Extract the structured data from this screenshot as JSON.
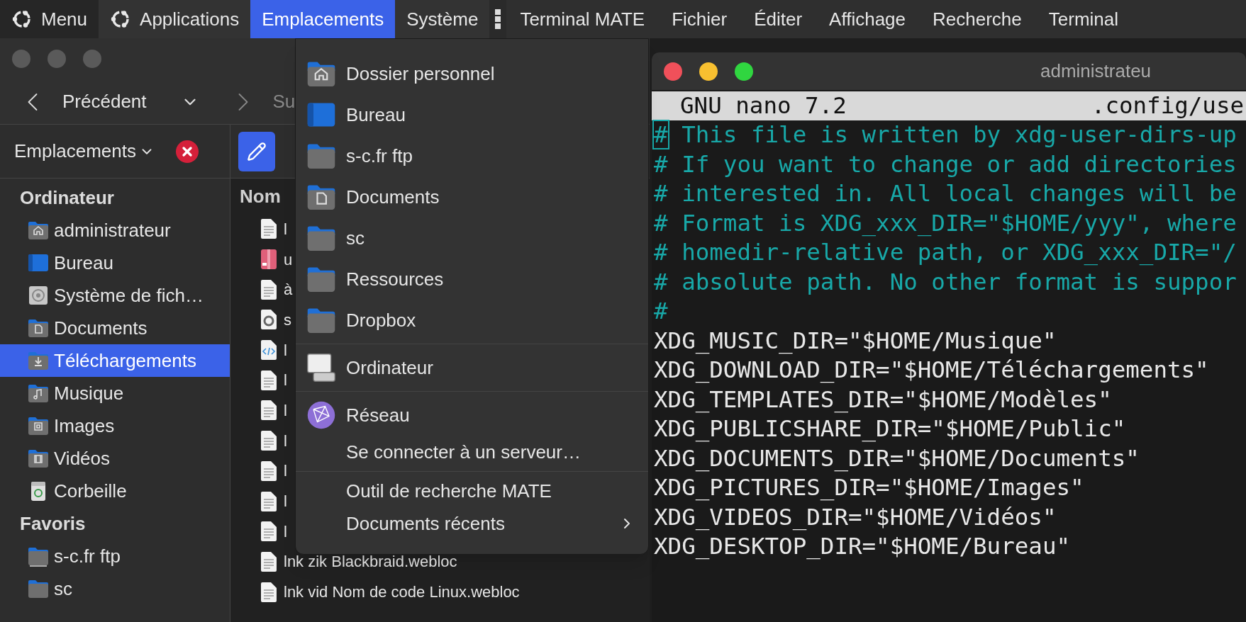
{
  "top_panel": {
    "items": [
      {
        "label": "Menu",
        "kind": "logo",
        "selected": false
      },
      {
        "label": "Applications",
        "kind": "logo",
        "selected": false
      },
      {
        "label": "Emplacements",
        "kind": "plain",
        "selected": true
      },
      {
        "label": "Système",
        "kind": "plain",
        "selected": false
      }
    ],
    "app_menus": [
      "Terminal MATE",
      "Fichier",
      "Éditer",
      "Affichage",
      "Recherche",
      "Terminal"
    ]
  },
  "file_manager": {
    "toolbar": {
      "back": "Précédent",
      "forward": "Su"
    },
    "sidebar": {
      "header": "Emplacements",
      "sections": [
        {
          "title": "Ordinateur",
          "items": [
            {
              "label": "administrateur",
              "kind": "home",
              "selected": false
            },
            {
              "label": "Bureau",
              "kind": "desktop",
              "selected": false
            },
            {
              "label": "Système de fich…",
              "kind": "disk",
              "selected": false
            },
            {
              "label": "Documents",
              "kind": "documents",
              "selected": false
            },
            {
              "label": "Téléchargements",
              "kind": "download",
              "selected": true
            },
            {
              "label": "Musique",
              "kind": "music",
              "selected": false
            },
            {
              "label": "Images",
              "kind": "pictures",
              "selected": false
            },
            {
              "label": "Vidéos",
              "kind": "videos",
              "selected": false
            },
            {
              "label": "Corbeille",
              "kind": "trash",
              "selected": false
            }
          ]
        },
        {
          "title": "Favoris",
          "items": [
            {
              "label": "s-c.fr ftp",
              "kind": "remote",
              "selected": false
            },
            {
              "label": "sc",
              "kind": "folder",
              "selected": false
            }
          ]
        }
      ]
    },
    "columns": [
      "Nom"
    ],
    "files": [
      {
        "name": "l",
        "kind": "text"
      },
      {
        "name": "u",
        "kind": "archive"
      },
      {
        "name": "à",
        "kind": "text"
      },
      {
        "name": "s",
        "kind": "disc"
      },
      {
        "name": "l",
        "kind": "code"
      },
      {
        "name": "l",
        "kind": "text"
      },
      {
        "name": "l",
        "kind": "text"
      },
      {
        "name": "l",
        "kind": "text"
      },
      {
        "name": "l",
        "kind": "text"
      },
      {
        "name": "l",
        "kind": "text"
      },
      {
        "name": "l",
        "kind": "text"
      },
      {
        "name": "lnk zik Blackbraid.webloc",
        "kind": "text"
      },
      {
        "name": "lnk vid Nom de code Linux.webloc",
        "kind": "text"
      }
    ]
  },
  "places_menu": {
    "groups": [
      [
        {
          "label": "Dossier personnel",
          "kind": "home"
        },
        {
          "label": "Bureau",
          "kind": "desktop"
        },
        {
          "label": "s-c.fr ftp",
          "kind": "folder"
        },
        {
          "label": "Documents",
          "kind": "documents"
        },
        {
          "label": "sc",
          "kind": "folder"
        },
        {
          "label": "Ressources",
          "kind": "folder"
        },
        {
          "label": "Dropbox",
          "kind": "folder"
        }
      ],
      [
        {
          "label": "Ordinateur",
          "kind": "computer"
        }
      ],
      [
        {
          "label": "Réseau",
          "kind": "network"
        },
        {
          "label": "Se connecter à un serveur…",
          "kind": "plain"
        }
      ],
      [
        {
          "label": "Outil de recherche MATE",
          "kind": "plain"
        },
        {
          "label": "Documents récents",
          "kind": "submenu"
        }
      ]
    ]
  },
  "terminal": {
    "title": "administrateu",
    "nano_header": {
      "version": "GNU nano 7.2",
      "file": ".config/use"
    },
    "lines": [
      {
        "kind": "comment",
        "text": "# This file is written by xdg-user-dirs-up",
        "cursor": true
      },
      {
        "kind": "comment",
        "text": "# If you want to change or add directories",
        "cursor": false
      },
      {
        "kind": "comment",
        "text": "# interested in. All local changes will be",
        "cursor": false
      },
      {
        "kind": "comment",
        "text": "# Format is XDG_xxx_DIR=\"$HOME/yyy\", where",
        "cursor": false
      },
      {
        "kind": "comment",
        "text": "# homedir-relative path, or XDG_xxx_DIR=\"/",
        "cursor": false
      },
      {
        "kind": "comment",
        "text": "# absolute path. No other format is suppor",
        "cursor": false
      },
      {
        "kind": "comment",
        "text": "#",
        "cursor": false
      },
      {
        "kind": "code",
        "text": "XDG_MUSIC_DIR=\"$HOME/Musique\"",
        "cursor": false
      },
      {
        "kind": "code",
        "text": "XDG_DOWNLOAD_DIR=\"$HOME/Téléchargements\"",
        "cursor": false
      },
      {
        "kind": "code",
        "text": "XDG_TEMPLATES_DIR=\"$HOME/Modèles\"",
        "cursor": false
      },
      {
        "kind": "code",
        "text": "XDG_PUBLICSHARE_DIR=\"$HOME/Public\"",
        "cursor": false
      },
      {
        "kind": "code",
        "text": "XDG_DOCUMENTS_DIR=\"$HOME/Documents\"",
        "cursor": false
      },
      {
        "kind": "code",
        "text": "XDG_PICTURES_DIR=\"$HOME/Images\"",
        "cursor": false
      },
      {
        "kind": "code",
        "text": "XDG_VIDEOS_DIR=\"$HOME/Vidéos\"",
        "cursor": false
      },
      {
        "kind": "code",
        "text": "XDG_DESKTOP_DIR=\"$HOME/Bureau\"",
        "cursor": false
      }
    ]
  }
}
